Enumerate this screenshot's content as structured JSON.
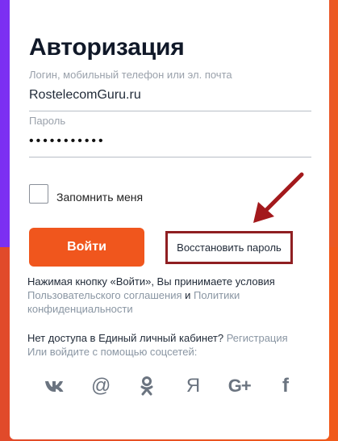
{
  "form": {
    "title": "Авторизация",
    "login_label": "Логин, мобильный телефон или эл. почта",
    "login_value": "RostelecomGuru.ru",
    "password_label": "Пароль",
    "password_value": "•••••••••••",
    "remember_label": "Запомнить меня",
    "login_button": "Войти",
    "restore_link": "Восстановить пароль"
  },
  "terms": {
    "text1": "Нажимая кнопку «Войти», Вы принимаете условия",
    "link1": "Пользовательского соглашения",
    "and": " и ",
    "link2": "Политики конфиденциальности"
  },
  "access": {
    "text": "Нет доступа в Единый личный кабинет? ",
    "register_link": "Регистрация",
    "social_text": "Или войдите с помощью соцсетей:"
  },
  "socials": {
    "items": [
      {
        "name": "vk-icon",
        "glyph": ""
      },
      {
        "name": "mail-icon",
        "glyph": "@"
      },
      {
        "name": "odnoklassniki-icon",
        "glyph": ""
      },
      {
        "name": "yandex-icon",
        "glyph": "Я"
      },
      {
        "name": "google-plus-icon",
        "glyph": "G+"
      },
      {
        "name": "facebook-icon",
        "glyph": "f"
      }
    ]
  },
  "colors": {
    "accent": "#f0561d",
    "highlight": "#8f1f22",
    "purple": "#7b2ff2"
  }
}
